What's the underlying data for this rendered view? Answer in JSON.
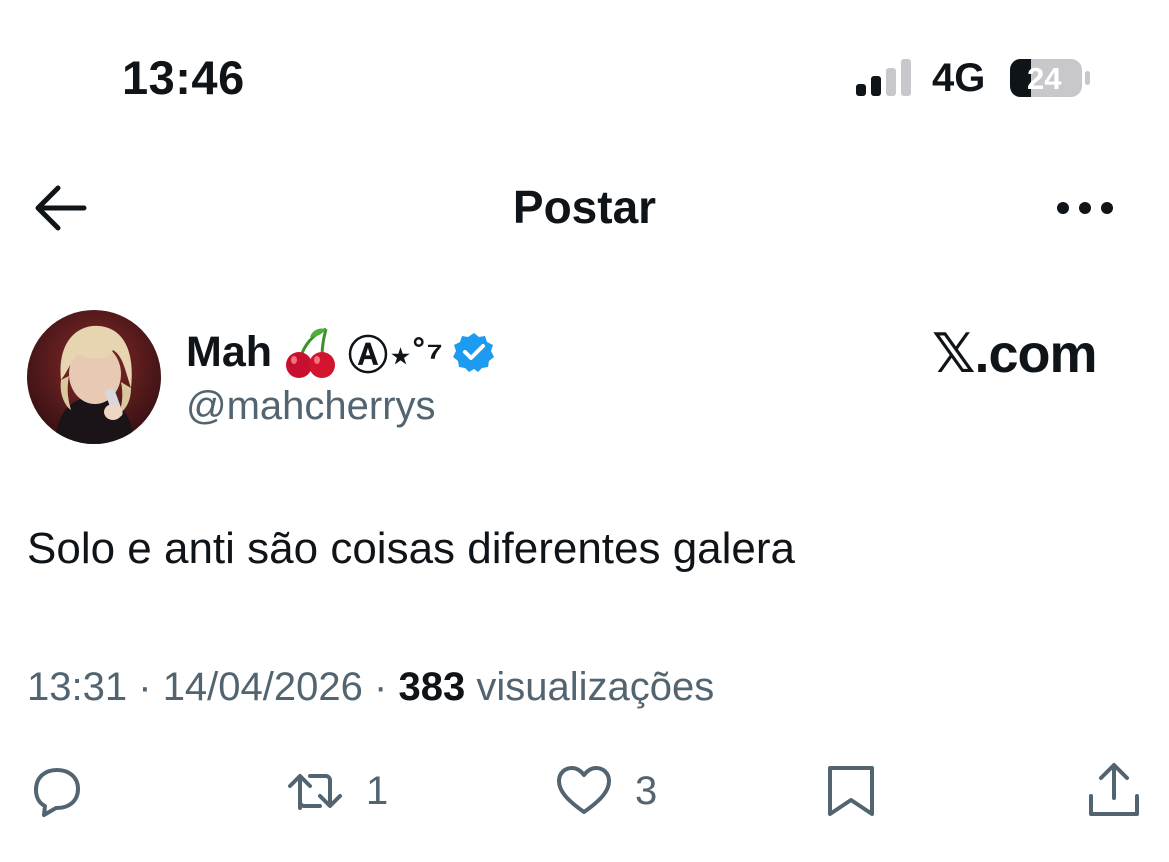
{
  "status_bar": {
    "time": "13:46",
    "network": "4G",
    "battery": "24"
  },
  "nav": {
    "title": "Postar",
    "back_icon": "arrow-left-icon",
    "more_icon": "more-horizontal-icon"
  },
  "post": {
    "author": {
      "name": "Mah",
      "name_emoji": "cherry-emoji",
      "name_decoration": "Ⓐ⋆˚⁷",
      "handle": "@mahcherrys",
      "verified": true
    },
    "brand": "𝕏.com",
    "text": "Solo e anti são coisas diferentes galera",
    "meta": {
      "time": "13:31",
      "separator1": "·",
      "date": "14/04/2026",
      "separator2": "·",
      "views_count": "383",
      "views_label": "visualizações"
    },
    "actions": {
      "reply_icon": "reply-icon",
      "retweet_icon": "retweet-icon",
      "retweet_count": "1",
      "like_icon": "heart-icon",
      "like_count": "3",
      "bookmark_icon": "bookmark-icon",
      "share_icon": "share-icon"
    }
  },
  "colors": {
    "text_primary": "#0f1419",
    "text_secondary": "#536471",
    "verified_blue": "#1d9bf0"
  }
}
